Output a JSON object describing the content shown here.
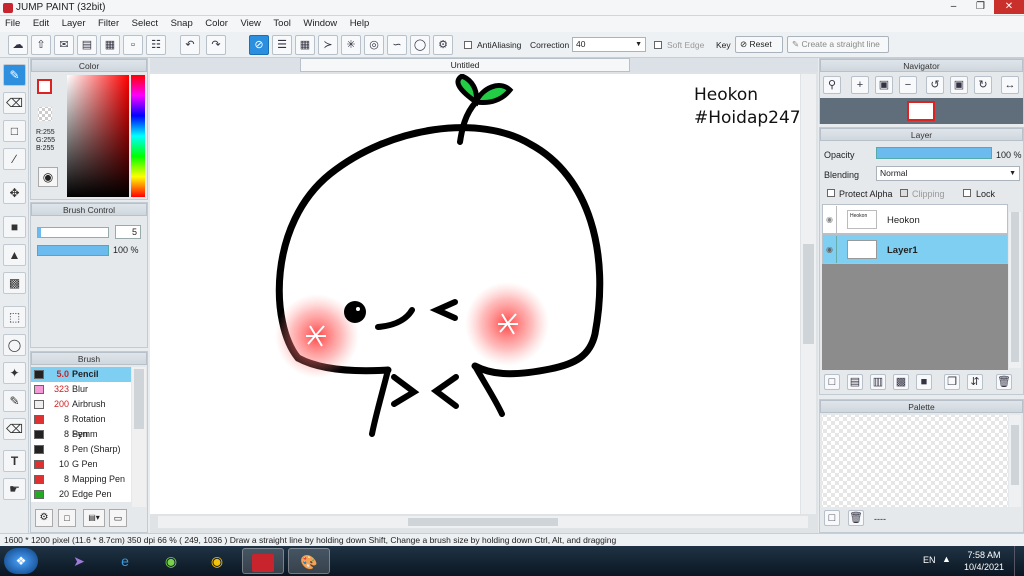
{
  "app": {
    "title": "JUMP PAINT (32bit)"
  },
  "menu": [
    "File",
    "Edit",
    "Layer",
    "Filter",
    "Select",
    "Snap",
    "Color",
    "View",
    "Tool",
    "Window",
    "Help"
  ],
  "toolbar": {
    "antialiasing_label": "AntiAliasing",
    "correction_label": "Correction",
    "correction_value": "40",
    "soft_edge_label": "Soft Edge",
    "key_label": "Key",
    "reset_label": "Reset",
    "straight_line_label": "Create a straight line"
  },
  "color_panel": {
    "title": "Color",
    "r": "R:255",
    "g": "G:255",
    "b": "B:255"
  },
  "brush_control": {
    "title": "Brush Control",
    "size_value": "5",
    "opacity_value": "100 %"
  },
  "brush_panel": {
    "title": "Brush",
    "items": [
      {
        "size": "5.0",
        "name": "Pencil",
        "swatch": "#222222"
      },
      {
        "size": "323",
        "name": "Blur",
        "swatch": "#f49ad6"
      },
      {
        "size": "200",
        "name": "Airbrush",
        "swatch": "#eeeeee"
      },
      {
        "size": "8",
        "name": "Rotation Symm",
        "swatch": "#e03030"
      },
      {
        "size": "8",
        "name": "Pen",
        "swatch": "#222222"
      },
      {
        "size": "8",
        "name": "Pen (Sharp)",
        "swatch": "#222222"
      },
      {
        "size": "10",
        "name": "G Pen",
        "swatch": "#e03030"
      },
      {
        "size": "8",
        "name": "Mapping Pen",
        "swatch": "#e03030"
      },
      {
        "size": "20",
        "name": "Edge Pen",
        "swatch": "#22aa22"
      }
    ]
  },
  "canvas": {
    "tab_title": "Untitled",
    "watermark_line1": "Heokon",
    "watermark_line2": "#Hoidap247"
  },
  "navigator": {
    "title": "Navigator"
  },
  "layer_panel": {
    "title": "Layer",
    "opacity_label": "Opacity",
    "opacity_value": "100 %",
    "blending_label": "Blending",
    "blending_value": "Normal",
    "protect_alpha": "Protect Alpha",
    "clipping": "Clipping",
    "lock": "Lock",
    "layers": [
      {
        "name": "Heokon"
      },
      {
        "name": "Layer1"
      }
    ]
  },
  "palette": {
    "title": "Palette",
    "dots": "----"
  },
  "status": {
    "text": "1600 * 1200 pixel   (11.6 * 8.7cm)   350 dpi   66 %   ( 249, 1036 )   Draw a straight line by holding down Shift, Change a brush size by holding down Ctrl, Alt, and dragging"
  },
  "taskbar": {
    "lang": "EN",
    "time": "7:58 AM",
    "date": "10/4/2021"
  }
}
